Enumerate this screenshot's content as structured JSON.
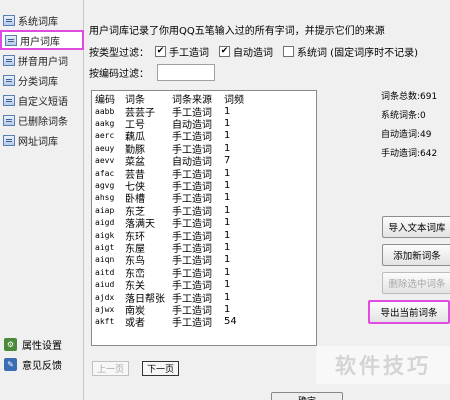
{
  "sidebar": {
    "items": [
      {
        "label": "系统词库",
        "icon": "system-lexicon-icon"
      },
      {
        "label": "用户词库",
        "icon": "user-lexicon-icon"
      },
      {
        "label": "拼音用户词",
        "icon": "pinyin-user-words-icon"
      },
      {
        "label": "分类词库",
        "icon": "category-lexicon-icon"
      },
      {
        "label": "自定义短语",
        "icon": "custom-phrase-icon"
      },
      {
        "label": "已删除词条",
        "icon": "deleted-entries-icon"
      },
      {
        "label": "网址词库",
        "icon": "url-lexicon-icon"
      }
    ],
    "bottom": [
      {
        "label": "属性设置",
        "icon": "settings-icon"
      },
      {
        "label": "意见反馈",
        "icon": "feedback-icon"
      }
    ]
  },
  "main": {
    "description": "用户词库记录了你用QQ五笔输入过的所有字词，并提示它们的来源",
    "filter": {
      "label": "按类型过滤：",
      "options": [
        {
          "label": "手工造词",
          "checked": true
        },
        {
          "label": "自动造词",
          "checked": true
        },
        {
          "label": "系统词 (固定词序时不记录)",
          "checked": false
        }
      ]
    },
    "code_filter": {
      "label": "按编码过滤：",
      "value": ""
    },
    "table": {
      "columns": [
        "编码",
        "词条",
        "词条来源",
        "词频"
      ],
      "rows": [
        [
          "aabb",
          "芸芸子",
          "手工造词",
          "1"
        ],
        [
          "aakg",
          "工号",
          "自动造词",
          "1"
        ],
        [
          "aerc",
          "藕瓜",
          "手工造词",
          "1"
        ],
        [
          "aeuy",
          "勤豚",
          "手工造词",
          "1"
        ],
        [
          "aevv",
          "菜盆",
          "自动造词",
          "7"
        ],
        [
          "afac",
          "芸昔",
          "手工造词",
          "1"
        ],
        [
          "agvg",
          "七侠",
          "手工造词",
          "1"
        ],
        [
          "ahsg",
          "卧槽",
          "手工造词",
          "1"
        ],
        [
          "aiap",
          "东芝",
          "手工造词",
          "1"
        ],
        [
          "aigd",
          "落满天",
          "手工造词",
          "1"
        ],
        [
          "aigk",
          "东环",
          "手工造词",
          "1"
        ],
        [
          "aigt",
          "东屋",
          "手工造词",
          "1"
        ],
        [
          "aiqn",
          "东鸟",
          "手工造词",
          "1"
        ],
        [
          "aitd",
          "东峦",
          "手工造词",
          "1"
        ],
        [
          "aiud",
          "东关",
          "手工造词",
          "1"
        ],
        [
          "ajdx",
          "落日帮张",
          "手工造词",
          "1"
        ],
        [
          "ajwx",
          "南炭",
          "手工造词",
          "1"
        ],
        [
          "akft",
          "或者",
          "手工造词",
          "54"
        ]
      ]
    },
    "pager": {
      "prev": "上一页",
      "next": "下一页"
    },
    "stats": {
      "total": "词条总数:691",
      "system": "系统词条:0",
      "auto": "自动造词:49",
      "manual": "手动造词:642"
    },
    "buttons": {
      "import": "导入文本词库",
      "add": "添加新词条",
      "delete": "删除选中词条",
      "export": "导出当前词条"
    },
    "ok": "确定"
  },
  "watermark": "软件技巧",
  "colors": {
    "highlight": "#e04ce0",
    "background": "#f0f0f0"
  }
}
